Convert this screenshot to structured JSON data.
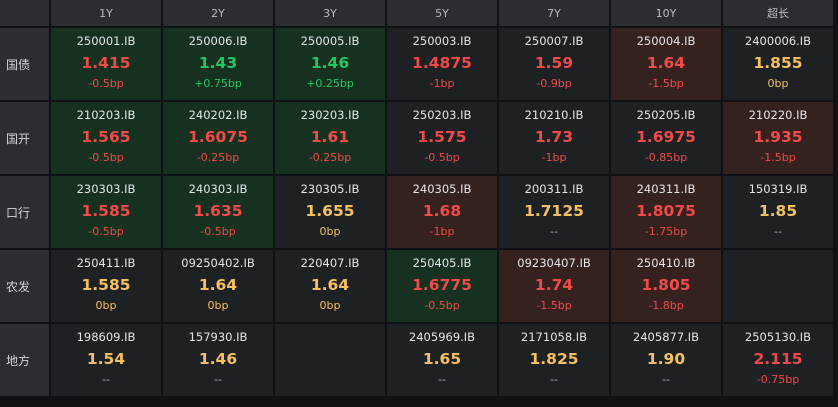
{
  "colors": {
    "up": "#f04a4a",
    "down": "#25c564",
    "flat": "#f6c060",
    "header_bg": "#2a2d31",
    "cell_bg": "#1e2124",
    "green_bg": "#16311f",
    "red_bg": "#35221f"
  },
  "columns": [
    "1Y",
    "2Y",
    "3Y",
    "5Y",
    "7Y",
    "10Y",
    "超长"
  ],
  "rows": [
    {
      "label": "国债",
      "cells": [
        {
          "code": "250001.IB",
          "yield": "1.415",
          "change": "-0.5bp",
          "color": "red",
          "bg": "green"
        },
        {
          "code": "250006.IB",
          "yield": "1.43",
          "change": "+0.75bp",
          "color": "green",
          "bg": "green"
        },
        {
          "code": "250005.IB",
          "yield": "1.46",
          "change": "+0.25bp",
          "color": "green",
          "bg": "green"
        },
        {
          "code": "250003.IB",
          "yield": "1.4875",
          "change": "-1bp",
          "color": "red",
          "bg": "none"
        },
        {
          "code": "250007.IB",
          "yield": "1.59",
          "change": "-0.9bp",
          "color": "red",
          "bg": "none"
        },
        {
          "code": "250004.IB",
          "yield": "1.64",
          "change": "-1.5bp",
          "color": "red",
          "bg": "red"
        },
        {
          "code": "2400006.IB",
          "yield": "1.855",
          "change": "0bp",
          "color": "flat",
          "bg": "none"
        }
      ]
    },
    {
      "label": "国开",
      "cells": [
        {
          "code": "210203.IB",
          "yield": "1.565",
          "change": "-0.5bp",
          "color": "red",
          "bg": "green"
        },
        {
          "code": "240202.IB",
          "yield": "1.6075",
          "change": "-0.25bp",
          "color": "red",
          "bg": "green"
        },
        {
          "code": "230203.IB",
          "yield": "1.61",
          "change": "-0.25bp",
          "color": "red",
          "bg": "green"
        },
        {
          "code": "250203.IB",
          "yield": "1.575",
          "change": "-0.5bp",
          "color": "red",
          "bg": "none"
        },
        {
          "code": "210210.IB",
          "yield": "1.73",
          "change": "-1bp",
          "color": "red",
          "bg": "none"
        },
        {
          "code": "250205.IB",
          "yield": "1.6975",
          "change": "-0.85bp",
          "color": "red",
          "bg": "none"
        },
        {
          "code": "210220.IB",
          "yield": "1.935",
          "change": "-1.5bp",
          "color": "red",
          "bg": "red"
        }
      ]
    },
    {
      "label": "口行",
      "cells": [
        {
          "code": "230303.IB",
          "yield": "1.585",
          "change": "-0.5bp",
          "color": "red",
          "bg": "green"
        },
        {
          "code": "240303.IB",
          "yield": "1.635",
          "change": "-0.5bp",
          "color": "red",
          "bg": "green"
        },
        {
          "code": "230305.IB",
          "yield": "1.655",
          "change": "0bp",
          "color": "flat",
          "bg": "none"
        },
        {
          "code": "240305.IB",
          "yield": "1.68",
          "change": "-1bp",
          "color": "red",
          "bg": "red"
        },
        {
          "code": "200311.IB",
          "yield": "1.7125",
          "change": "--",
          "color": "flat",
          "bg": "none"
        },
        {
          "code": "240311.IB",
          "yield": "1.8075",
          "change": "-1.75bp",
          "color": "red",
          "bg": "red"
        },
        {
          "code": "150319.IB",
          "yield": "1.85",
          "change": "--",
          "color": "flat",
          "bg": "none"
        }
      ]
    },
    {
      "label": "农发",
      "cells": [
        {
          "code": "250411.IB",
          "yield": "1.585",
          "change": "0bp",
          "color": "flat",
          "bg": "none"
        },
        {
          "code": "09250402.IB",
          "yield": "1.64",
          "change": "0bp",
          "color": "flat",
          "bg": "none"
        },
        {
          "code": "220407.IB",
          "yield": "1.64",
          "change": "0bp",
          "color": "flat",
          "bg": "none"
        },
        {
          "code": "250405.IB",
          "yield": "1.6775",
          "change": "-0.5bp",
          "color": "red",
          "bg": "green"
        },
        {
          "code": "09230407.IB",
          "yield": "1.74",
          "change": "-1.5bp",
          "color": "red",
          "bg": "red"
        },
        {
          "code": "250410.IB",
          "yield": "1.805",
          "change": "-1.8bp",
          "color": "red",
          "bg": "red"
        },
        {
          "code": "",
          "yield": "",
          "change": "",
          "color": "flat",
          "bg": "none"
        }
      ]
    },
    {
      "label": "地方",
      "cells": [
        {
          "code": "198609.IB",
          "yield": "1.54",
          "change": "--",
          "color": "flat",
          "bg": "none"
        },
        {
          "code": "157930.IB",
          "yield": "1.46",
          "change": "--",
          "color": "flat",
          "bg": "none"
        },
        {
          "code": "",
          "yield": "",
          "change": "",
          "color": "flat",
          "bg": "none"
        },
        {
          "code": "2405969.IB",
          "yield": "1.65",
          "change": "--",
          "color": "flat",
          "bg": "none"
        },
        {
          "code": "2171058.IB",
          "yield": "1.825",
          "change": "--",
          "color": "flat",
          "bg": "none"
        },
        {
          "code": "2405877.IB",
          "yield": "1.90",
          "change": "--",
          "color": "flat",
          "bg": "none"
        },
        {
          "code": "2505130.IB",
          "yield": "2.115",
          "change": "-0.75bp",
          "color": "red",
          "bg": "none"
        }
      ]
    }
  ]
}
